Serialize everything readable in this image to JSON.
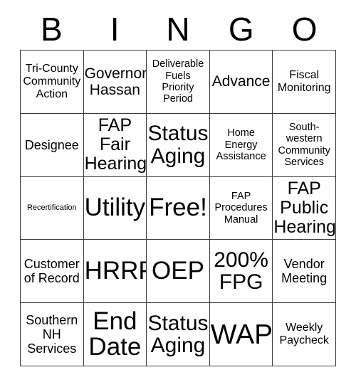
{
  "card": {
    "header_letters": [
      "B",
      "I",
      "N",
      "G",
      "O"
    ],
    "rows": [
      [
        {
          "text": "Tri-County\nCommunity\nAction",
          "size": "fs-s"
        },
        {
          "text": "Governor\nHassan",
          "size": "fs-l"
        },
        {
          "text": "Deliverable\nFuels\nPriority\nPeriod",
          "size": "fs-xs"
        },
        {
          "text": "Advance",
          "size": "fs-l"
        },
        {
          "text": "Fiscal\nMonitoring",
          "size": "fs-s"
        }
      ],
      [
        {
          "text": "Designee",
          "size": "fs-m"
        },
        {
          "text": "FAP\nFair\nHearing",
          "size": "fs-xl"
        },
        {
          "text": "Status\nAging",
          "size": "fs-xxl"
        },
        {
          "text": "Home\nEnergy\nAssistance",
          "size": "fs-xs"
        },
        {
          "text": "South-\nwestern\nCommunity\nServices",
          "size": "fs-xs"
        }
      ],
      [
        {
          "text": "Recertification",
          "size": "fs-xxs"
        },
        {
          "text": "Utility",
          "size": "fs-huge"
        },
        {
          "text": "Free!",
          "size": "fs-huge"
        },
        {
          "text": "FAP\nProcedures\nManual",
          "size": "fs-xs"
        },
        {
          "text": "FAP\nPublic\nHearing",
          "size": "fs-xl"
        }
      ],
      [
        {
          "text": "Customer\nof Record",
          "size": "fs-m"
        },
        {
          "text": "HRRP",
          "size": "fs-huge"
        },
        {
          "text": "OEP",
          "size": "fs-huge"
        },
        {
          "text": "200%\nFPG",
          "size": "fs-xxl"
        },
        {
          "text": "Vendor\nMeeting",
          "size": "fs-m"
        }
      ],
      [
        {
          "text": "Southern\nNH\nServices",
          "size": "fs-m"
        },
        {
          "text": "End\nDate",
          "size": "fs-huge"
        },
        {
          "text": "Status\nAging",
          "size": "fs-xxl"
        },
        {
          "text": "WAP",
          "size": "fs-mega"
        },
        {
          "text": "Weekly\nPaycheck",
          "size": "fs-s"
        }
      ]
    ]
  },
  "colors": {
    "border": "#3a3a3a",
    "background": "#ffffff",
    "text": "#000000"
  }
}
